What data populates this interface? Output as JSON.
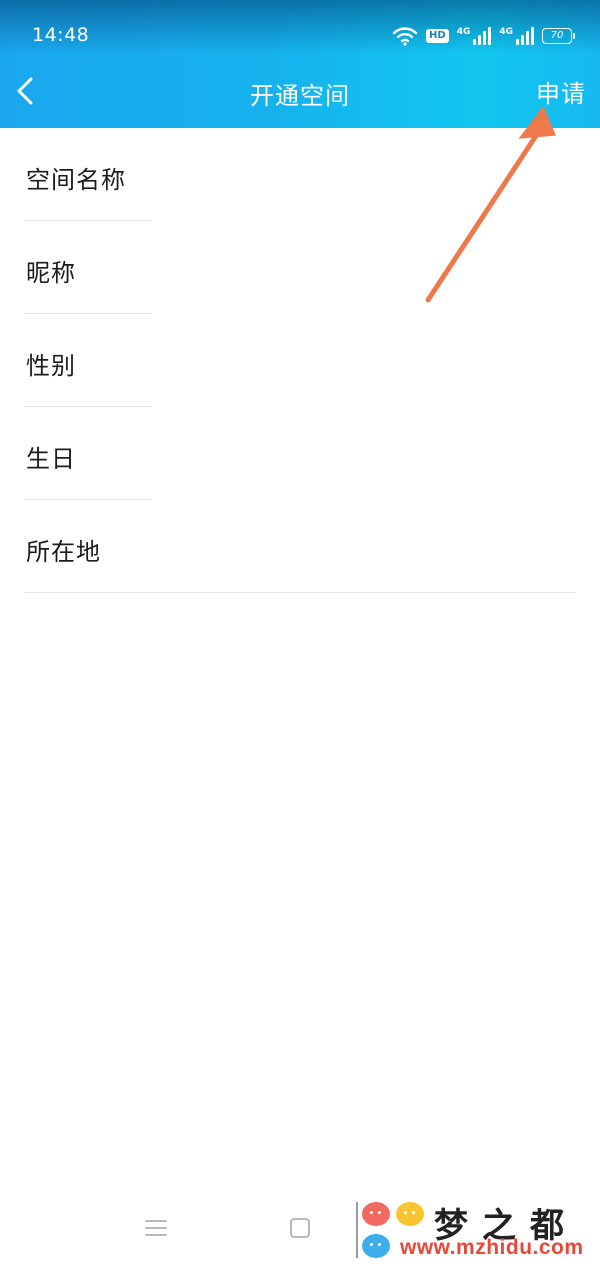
{
  "status_bar": {
    "time": "14:48",
    "hd_label": "HD",
    "network_1": "4G",
    "network_2": "4G",
    "battery": "70"
  },
  "header": {
    "title": "开通空间",
    "apply_label": "申请",
    "back_icon": "chevron-left-icon",
    "gradient_start": "#1aa7ee",
    "gradient_end": "#12c7f0"
  },
  "form": {
    "fields": [
      {
        "label": "空间名称"
      },
      {
        "label": "昵称"
      },
      {
        "label": "性别"
      },
      {
        "label": "生日"
      },
      {
        "label": "所在地"
      }
    ]
  },
  "annotation": {
    "arrow_color": "#ee7a4c"
  },
  "nav_bar": {
    "menu_icon": "menu-icon",
    "home_icon": "home-square-icon"
  },
  "watermark": {
    "title": "梦之都",
    "url": "www.mzhidu.com"
  }
}
